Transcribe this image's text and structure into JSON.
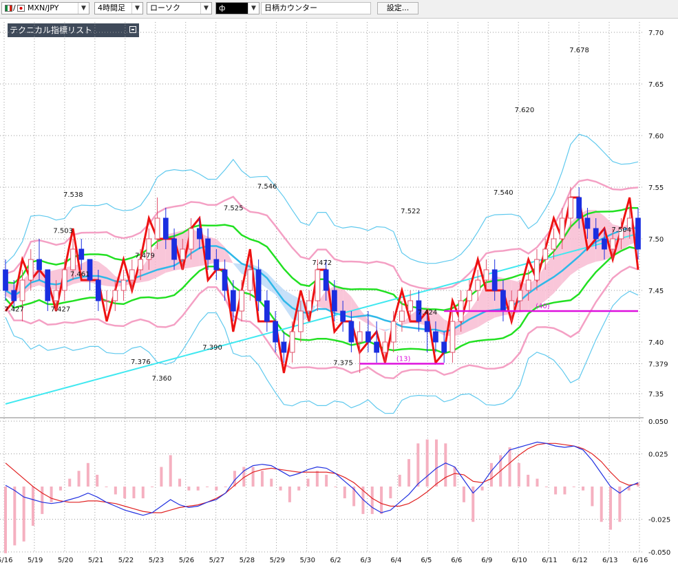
{
  "toolbar": {
    "pair": "MXN/JPY",
    "pair_slash": "/",
    "timeframe": "4時間足",
    "chart_type": "ローソク",
    "product": "ф",
    "counter": "日柄カウンター",
    "settings": "設定..."
  },
  "indicator_panel": {
    "label": "テクニカル指標リスト"
  },
  "colors": {
    "up_candle": "#e0506a",
    "down_candle": "#1a2ee0",
    "bb_outer": "#5fc9ee",
    "bb_mid": "#f4a0c4",
    "ma_green": "#22e022",
    "ma_cyan": "#2fb8e8",
    "ma_long": "#40e8f0",
    "red_line": "#ee1111",
    "cloud_up": "#f8b8d0",
    "cloud_down": "#b8d8f8",
    "macd_line": "#2030e0",
    "signal_line": "#e02020",
    "histogram": "#f5b0c0",
    "counter_line": "#dd10dd"
  },
  "chart_data": [
    {
      "type": "candlestick",
      "symbol": "MXN/JPY",
      "timeframe": "4時間足",
      "ylim": [
        7.33,
        7.71
      ],
      "y_ticks": [
        "7.70",
        "7.65",
        "7.60",
        "7.55",
        "7.50",
        "7.45",
        "7.40",
        "7.379",
        "7.35"
      ],
      "current_price": "7.379",
      "x_labels": [
        "5/16",
        "5/19",
        "5/20",
        "5/21",
        "5/22",
        "5/23",
        "5/26",
        "5/27",
        "5/28",
        "5/29",
        "5/30",
        "6/2",
        "6/3",
        "6/4",
        "6/5",
        "6/6",
        "6/9",
        "6/10",
        "6/11",
        "6/12",
        "6/13",
        "6/16"
      ],
      "price_labels": [
        {
          "text": "7.503",
          "x": 6.8,
          "y": 7.503
        },
        {
          "text": "7.538",
          "x": 8.0,
          "y": 7.538
        },
        {
          "text": "7.461",
          "x": 8.8,
          "y": 7.461
        },
        {
          "text": "7.479",
          "x": 16.5,
          "y": 7.479
        },
        {
          "text": "7.427",
          "x": 1.0,
          "y": 7.427
        },
        {
          "text": "7.427",
          "x": 6.5,
          "y": 7.427
        },
        {
          "text": "7.376",
          "x": 16.0,
          "y": 7.376
        },
        {
          "text": "7.360",
          "x": 18.5,
          "y": 7.36
        },
        {
          "text": "7.525",
          "x": 27.0,
          "y": 7.525
        },
        {
          "text": "7.546",
          "x": 31.0,
          "y": 7.546
        },
        {
          "text": "7.390",
          "x": 24.5,
          "y": 7.39
        },
        {
          "text": "7.472",
          "x": 37.5,
          "y": 7.472
        },
        {
          "text": "7.375",
          "x": 40.0,
          "y": 7.375
        },
        {
          "text": "7.522",
          "x": 48.0,
          "y": 7.522
        },
        {
          "text": "7.424",
          "x": 50.0,
          "y": 7.424
        },
        {
          "text": "7.540",
          "x": 59.0,
          "y": 7.54
        },
        {
          "text": "7.620",
          "x": 61.5,
          "y": 7.62
        },
        {
          "text": "7.678",
          "x": 68.0,
          "y": 7.678
        },
        {
          "text": "7.504",
          "x": 73.0,
          "y": 7.504
        }
      ],
      "counters": [
        {
          "label": "(13)",
          "x0": 42.0,
          "x1": 52.0,
          "y": 7.379
        },
        {
          "label": "(40)",
          "x0": 52.0,
          "x1": 75.0,
          "y": 7.43
        }
      ],
      "candles": [
        [
          7.47,
          7.48,
          7.44,
          7.45
        ],
        [
          7.45,
          7.46,
          7.43,
          7.44
        ],
        [
          7.44,
          7.47,
          7.42,
          7.46
        ],
        [
          7.46,
          7.49,
          7.45,
          7.48
        ],
        [
          7.48,
          7.5,
          7.46,
          7.47
        ],
        [
          7.47,
          7.47,
          7.43,
          7.44
        ],
        [
          7.44,
          7.46,
          7.43,
          7.45
        ],
        [
          7.45,
          7.48,
          7.44,
          7.47
        ],
        [
          7.47,
          7.5,
          7.46,
          7.49
        ],
        [
          7.49,
          7.5,
          7.47,
          7.48
        ],
        [
          7.48,
          7.48,
          7.45,
          7.46
        ],
        [
          7.46,
          7.47,
          7.43,
          7.44
        ],
        [
          7.44,
          7.45,
          7.43,
          7.44
        ],
        [
          7.44,
          7.46,
          7.43,
          7.45
        ],
        [
          7.45,
          7.47,
          7.44,
          7.46
        ],
        [
          7.46,
          7.48,
          7.45,
          7.47
        ],
        [
          7.47,
          7.49,
          7.46,
          7.48
        ],
        [
          7.48,
          7.51,
          7.47,
          7.5
        ],
        [
          7.5,
          7.54,
          7.49,
          7.52
        ],
        [
          7.52,
          7.53,
          7.49,
          7.5
        ],
        [
          7.5,
          7.51,
          7.47,
          7.48
        ],
        [
          7.48,
          7.5,
          7.47,
          7.49
        ],
        [
          7.49,
          7.52,
          7.48,
          7.51
        ],
        [
          7.51,
          7.52,
          7.49,
          7.5
        ],
        [
          7.5,
          7.51,
          7.47,
          7.48
        ],
        [
          7.48,
          7.49,
          7.46,
          7.47
        ],
        [
          7.47,
          7.48,
          7.44,
          7.45
        ],
        [
          7.45,
          7.46,
          7.42,
          7.43
        ],
        [
          7.43,
          7.46,
          7.42,
          7.45
        ],
        [
          7.45,
          7.48,
          7.44,
          7.47
        ],
        [
          7.47,
          7.48,
          7.43,
          7.44
        ],
        [
          7.44,
          7.45,
          7.41,
          7.42
        ],
        [
          7.42,
          7.43,
          7.39,
          7.4
        ],
        [
          7.4,
          7.41,
          7.38,
          7.39
        ],
        [
          7.39,
          7.42,
          7.38,
          7.41
        ],
        [
          7.41,
          7.44,
          7.4,
          7.43
        ],
        [
          7.43,
          7.45,
          7.42,
          7.44
        ],
        [
          7.44,
          7.48,
          7.43,
          7.47
        ],
        [
          7.47,
          7.48,
          7.44,
          7.45
        ],
        [
          7.45,
          7.46,
          7.42,
          7.43
        ],
        [
          7.43,
          7.44,
          7.41,
          7.42
        ],
        [
          7.42,
          7.43,
          7.39,
          7.4
        ],
        [
          7.4,
          7.42,
          7.37,
          7.41
        ],
        [
          7.41,
          7.43,
          7.39,
          7.4
        ],
        [
          7.4,
          7.42,
          7.38,
          7.39
        ],
        [
          7.39,
          7.41,
          7.38,
          7.4
        ],
        [
          7.4,
          7.43,
          7.39,
          7.42
        ],
        [
          7.42,
          7.44,
          7.41,
          7.43
        ],
        [
          7.43,
          7.45,
          7.42,
          7.44
        ],
        [
          7.44,
          7.45,
          7.41,
          7.42
        ],
        [
          7.42,
          7.43,
          7.39,
          7.41
        ],
        [
          7.41,
          7.42,
          7.39,
          7.4
        ],
        [
          7.4,
          7.41,
          7.38,
          7.39
        ],
        [
          7.39,
          7.43,
          7.38,
          7.42
        ],
        [
          7.42,
          7.45,
          7.41,
          7.44
        ],
        [
          7.44,
          7.46,
          7.43,
          7.45
        ],
        [
          7.45,
          7.47,
          7.44,
          7.46
        ],
        [
          7.46,
          7.48,
          7.45,
          7.47
        ],
        [
          7.47,
          7.48,
          7.44,
          7.45
        ],
        [
          7.45,
          7.46,
          7.42,
          7.43
        ],
        [
          7.43,
          7.45,
          7.42,
          7.44
        ],
        [
          7.44,
          7.46,
          7.43,
          7.45
        ],
        [
          7.45,
          7.47,
          7.44,
          7.46
        ],
        [
          7.46,
          7.49,
          7.45,
          7.48
        ],
        [
          7.48,
          7.5,
          7.47,
          7.49
        ],
        [
          7.49,
          7.51,
          7.48,
          7.5
        ],
        [
          7.5,
          7.53,
          7.49,
          7.52
        ],
        [
          7.52,
          7.55,
          7.51,
          7.54
        ],
        [
          7.54,
          7.55,
          7.51,
          7.52
        ],
        [
          7.52,
          7.53,
          7.5,
          7.51
        ],
        [
          7.51,
          7.52,
          7.49,
          7.5
        ],
        [
          7.5,
          7.51,
          7.48,
          7.49
        ],
        [
          7.49,
          7.51,
          7.48,
          7.5
        ],
        [
          7.5,
          7.52,
          7.49,
          7.51
        ],
        [
          7.51,
          7.53,
          7.5,
          7.52
        ],
        [
          7.52,
          7.53,
          7.48,
          7.49
        ]
      ]
    },
    {
      "type": "macd",
      "ylim": [
        -0.05,
        0.05
      ],
      "y_ticks": [
        "0.050",
        "0.025",
        "-0.025",
        "-0.050"
      ],
      "macd": [
        0.001,
        -0.003,
        -0.008,
        -0.01,
        -0.012,
        -0.013,
        -0.012,
        -0.01,
        -0.008,
        -0.005,
        -0.008,
        -0.012,
        -0.015,
        -0.018,
        -0.02,
        -0.022,
        -0.02,
        -0.015,
        -0.01,
        -0.014,
        -0.016,
        -0.015,
        -0.012,
        -0.01,
        -0.005,
        0.005,
        0.012,
        0.016,
        0.017,
        0.016,
        0.012,
        0.008,
        0.01,
        0.013,
        0.015,
        0.014,
        0.01,
        0.004,
        -0.002,
        -0.01,
        -0.016,
        -0.02,
        -0.018,
        -0.012,
        -0.006,
        0.002,
        0.008,
        0.014,
        0.018,
        0.015,
        0.005,
        -0.005,
        0.002,
        0.012,
        0.02,
        0.028,
        0.03,
        0.032,
        0.034,
        0.033,
        0.031,
        0.03,
        0.031,
        0.028,
        0.02,
        0.01,
        0.0,
        -0.005,
        0.0,
        0.003
      ],
      "signal": [
        0.018,
        0.012,
        0.006,
        0.0,
        -0.005,
        -0.009,
        -0.011,
        -0.012,
        -0.012,
        -0.011,
        -0.011,
        -0.012,
        -0.013,
        -0.015,
        -0.017,
        -0.019,
        -0.02,
        -0.02,
        -0.018,
        -0.016,
        -0.015,
        -0.014,
        -0.012,
        -0.009,
        -0.005,
        0.001,
        0.007,
        0.011,
        0.013,
        0.014,
        0.013,
        0.012,
        0.011,
        0.011,
        0.011,
        0.011,
        0.01,
        0.007,
        0.003,
        -0.003,
        -0.009,
        -0.013,
        -0.015,
        -0.015,
        -0.013,
        -0.009,
        -0.004,
        0.002,
        0.007,
        0.01,
        0.009,
        0.004,
        0.003,
        0.006,
        0.012,
        0.018,
        0.024,
        0.029,
        0.032,
        0.033,
        0.033,
        0.032,
        0.031,
        0.029,
        0.025,
        0.019,
        0.011,
        0.004,
        0.001,
        0.002
      ]
    }
  ]
}
